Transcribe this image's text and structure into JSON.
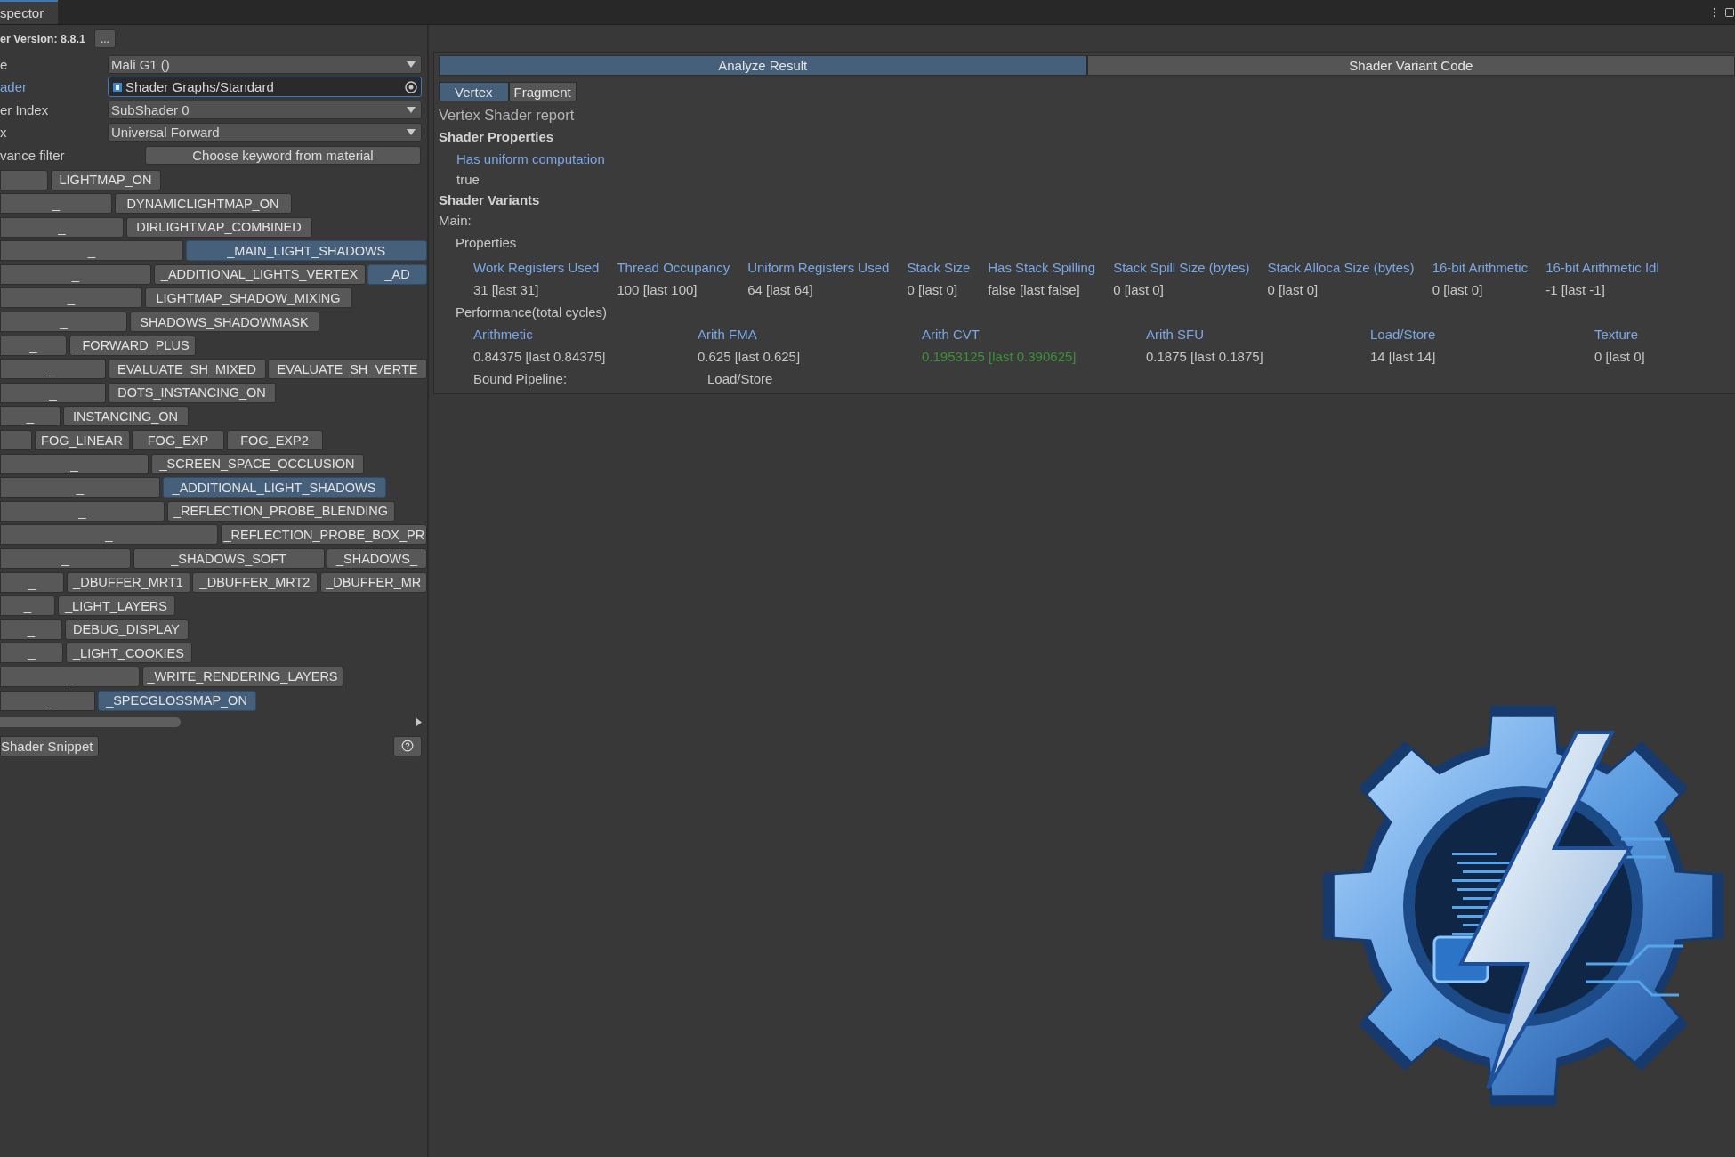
{
  "window": {
    "tab": "spector",
    "version_label": "er Version: 8.8.1",
    "version_button": "..."
  },
  "fields": [
    {
      "label": "e",
      "kind": "dropdown",
      "value": "Mali G1 ()",
      "focused": false
    },
    {
      "label": "ader",
      "kind": "object",
      "value": "Shader Graphs/Standard",
      "focused": true
    },
    {
      "label": "er Index",
      "kind": "dropdown",
      "value": "SubShader 0",
      "focused": false
    },
    {
      "label": "x",
      "kind": "dropdown",
      "value": "Universal Forward",
      "focused": false
    },
    {
      "label": "vance filter",
      "kind": "button",
      "value": "Choose keyword from material",
      "focused": false
    }
  ],
  "keyword_rows": [
    {
      "keywords": [
        {
          "label": "LIGHTMAP_ON",
          "selected": false
        }
      ]
    },
    {
      "toggle": "_",
      "keywords": [
        {
          "label": "DYNAMICLIGHTMAP_ON",
          "selected": false
        }
      ]
    },
    {
      "toggle": "_",
      "keywords": [
        {
          "label": "DIRLIGHTMAP_COMBINED",
          "selected": false
        }
      ]
    },
    {
      "toggle": "_",
      "keywords": [
        {
          "label": "_MAIN_LIGHT_SHADOWS",
          "selected": true
        }
      ]
    },
    {
      "toggle": "_",
      "keywords": [
        {
          "label": "_ADDITIONAL_LIGHTS_VERTEX",
          "selected": false
        },
        {
          "label": "_AD",
          "selected": true
        }
      ]
    },
    {
      "toggle": "_",
      "keywords": [
        {
          "label": "LIGHTMAP_SHADOW_MIXING",
          "selected": false
        }
      ]
    },
    {
      "toggle": "_",
      "keywords": [
        {
          "label": "SHADOWS_SHADOWMASK",
          "selected": false
        }
      ]
    },
    {
      "toggle": "_",
      "keywords": [
        {
          "label": "_FORWARD_PLUS",
          "selected": false
        }
      ]
    },
    {
      "toggle": "_",
      "keywords": [
        {
          "label": "EVALUATE_SH_MIXED",
          "selected": false
        },
        {
          "label": "EVALUATE_SH_VERTE",
          "selected": false
        }
      ]
    },
    {
      "toggle": "_",
      "keywords": [
        {
          "label": "DOTS_INSTANCING_ON",
          "selected": false
        }
      ]
    },
    {
      "toggle": "_",
      "keywords": [
        {
          "label": "INSTANCING_ON",
          "selected": false
        }
      ]
    },
    {
      "keywords": [
        {
          "label": "FOG_LINEAR",
          "selected": false
        },
        {
          "label": "FOG_EXP",
          "selected": false
        },
        {
          "label": "FOG_EXP2",
          "selected": false
        }
      ]
    },
    {
      "toggle": "_",
      "keywords": [
        {
          "label": "_SCREEN_SPACE_OCCLUSION",
          "selected": false
        }
      ]
    },
    {
      "toggle": "_",
      "keywords": [
        {
          "label": "_ADDITIONAL_LIGHT_SHADOWS",
          "selected": true
        }
      ]
    },
    {
      "toggle": "_",
      "keywords": [
        {
          "label": "_REFLECTION_PROBE_BLENDING",
          "selected": false
        }
      ]
    },
    {
      "toggle": "_",
      "keywords": [
        {
          "label": "_REFLECTION_PROBE_BOX_PR",
          "selected": false
        }
      ]
    },
    {
      "toggle": "_",
      "keywords": [
        {
          "label": "_SHADOWS_SOFT",
          "selected": false
        },
        {
          "label": "_SHADOWS_",
          "selected": false
        }
      ]
    },
    {
      "toggle": "_",
      "keywords": [
        {
          "label": "_DBUFFER_MRT1",
          "selected": false
        },
        {
          "label": "_DBUFFER_MRT2",
          "selected": false
        },
        {
          "label": "_DBUFFER_MR",
          "selected": false
        }
      ]
    },
    {
      "toggle": "_",
      "keywords": [
        {
          "label": "_LIGHT_LAYERS",
          "selected": false
        }
      ]
    },
    {
      "toggle": "_",
      "keywords": [
        {
          "label": "DEBUG_DISPLAY",
          "selected": false
        }
      ]
    },
    {
      "toggle": "_",
      "keywords": [
        {
          "label": "_LIGHT_COOKIES",
          "selected": false
        }
      ]
    },
    {
      "toggle": "_",
      "keywords": [
        {
          "label": "_WRITE_RENDERING_LAYERS",
          "selected": false
        }
      ]
    },
    {
      "toggle": "_",
      "keywords": [
        {
          "label": "_SPECGLOSSMAP_ON",
          "selected": true
        }
      ]
    }
  ],
  "snippet_button": "Shader Snippet",
  "result_tabs": [
    {
      "label": "Analyze Result",
      "selected": true
    },
    {
      "label": "Shader Variant Code",
      "selected": false
    }
  ],
  "stage_tabs": [
    {
      "label": "Vertex",
      "selected": true
    },
    {
      "label": "Fragment",
      "selected": false
    }
  ],
  "report": {
    "title": "Vertex Shader report",
    "properties_heading": "Shader Properties",
    "property_name": "Has uniform computation",
    "property_value": "true",
    "variants_heading": "Shader Variants",
    "main_label": "Main:",
    "properties_label": "Properties",
    "properties": [
      {
        "name": "Work Registers Used",
        "value": "31 [last 31]"
      },
      {
        "name": "Thread Occupancy",
        "value": "100 [last 100]"
      },
      {
        "name": "Uniform Registers Used",
        "value": "64 [last 64]"
      },
      {
        "name": "Stack Size",
        "value": "0 [last 0]"
      },
      {
        "name": "Has Stack Spilling",
        "value": "false [last false]"
      },
      {
        "name": "Stack Spill Size (bytes)",
        "value": "0 [last 0]"
      },
      {
        "name": "Stack Alloca Size (bytes)",
        "value": "0 [last 0]"
      },
      {
        "name": "16-bit Arithmetic",
        "value": "0 [last 0]"
      },
      {
        "name": "16-bit Arithmetic Idl",
        "value": "-1 [last -1]"
      }
    ],
    "performance_label": "Performance(total cycles)",
    "performance": [
      {
        "name": "Arithmetic",
        "value": "0.84375 [last 0.84375]",
        "color": "#c4c4c4"
      },
      {
        "name": "Arith FMA",
        "value": "0.625 [last 0.625]",
        "color": "#c4c4c4"
      },
      {
        "name": "Arith CVT",
        "value": "0.1953125 [last 0.390625]",
        "color": "#3f8f3a"
      },
      {
        "name": "Arith SFU",
        "value": "0.1875 [last 0.1875]",
        "color": "#c4c4c4"
      },
      {
        "name": "Load/Store",
        "value": "14 [last 14]",
        "color": "#c4c4c4"
      },
      {
        "name": "Texture",
        "value": "0 [last 0]",
        "color": "#c4c4c4"
      }
    ],
    "bound_label": "Bound Pipeline:",
    "bound_value": "Load/Store"
  }
}
